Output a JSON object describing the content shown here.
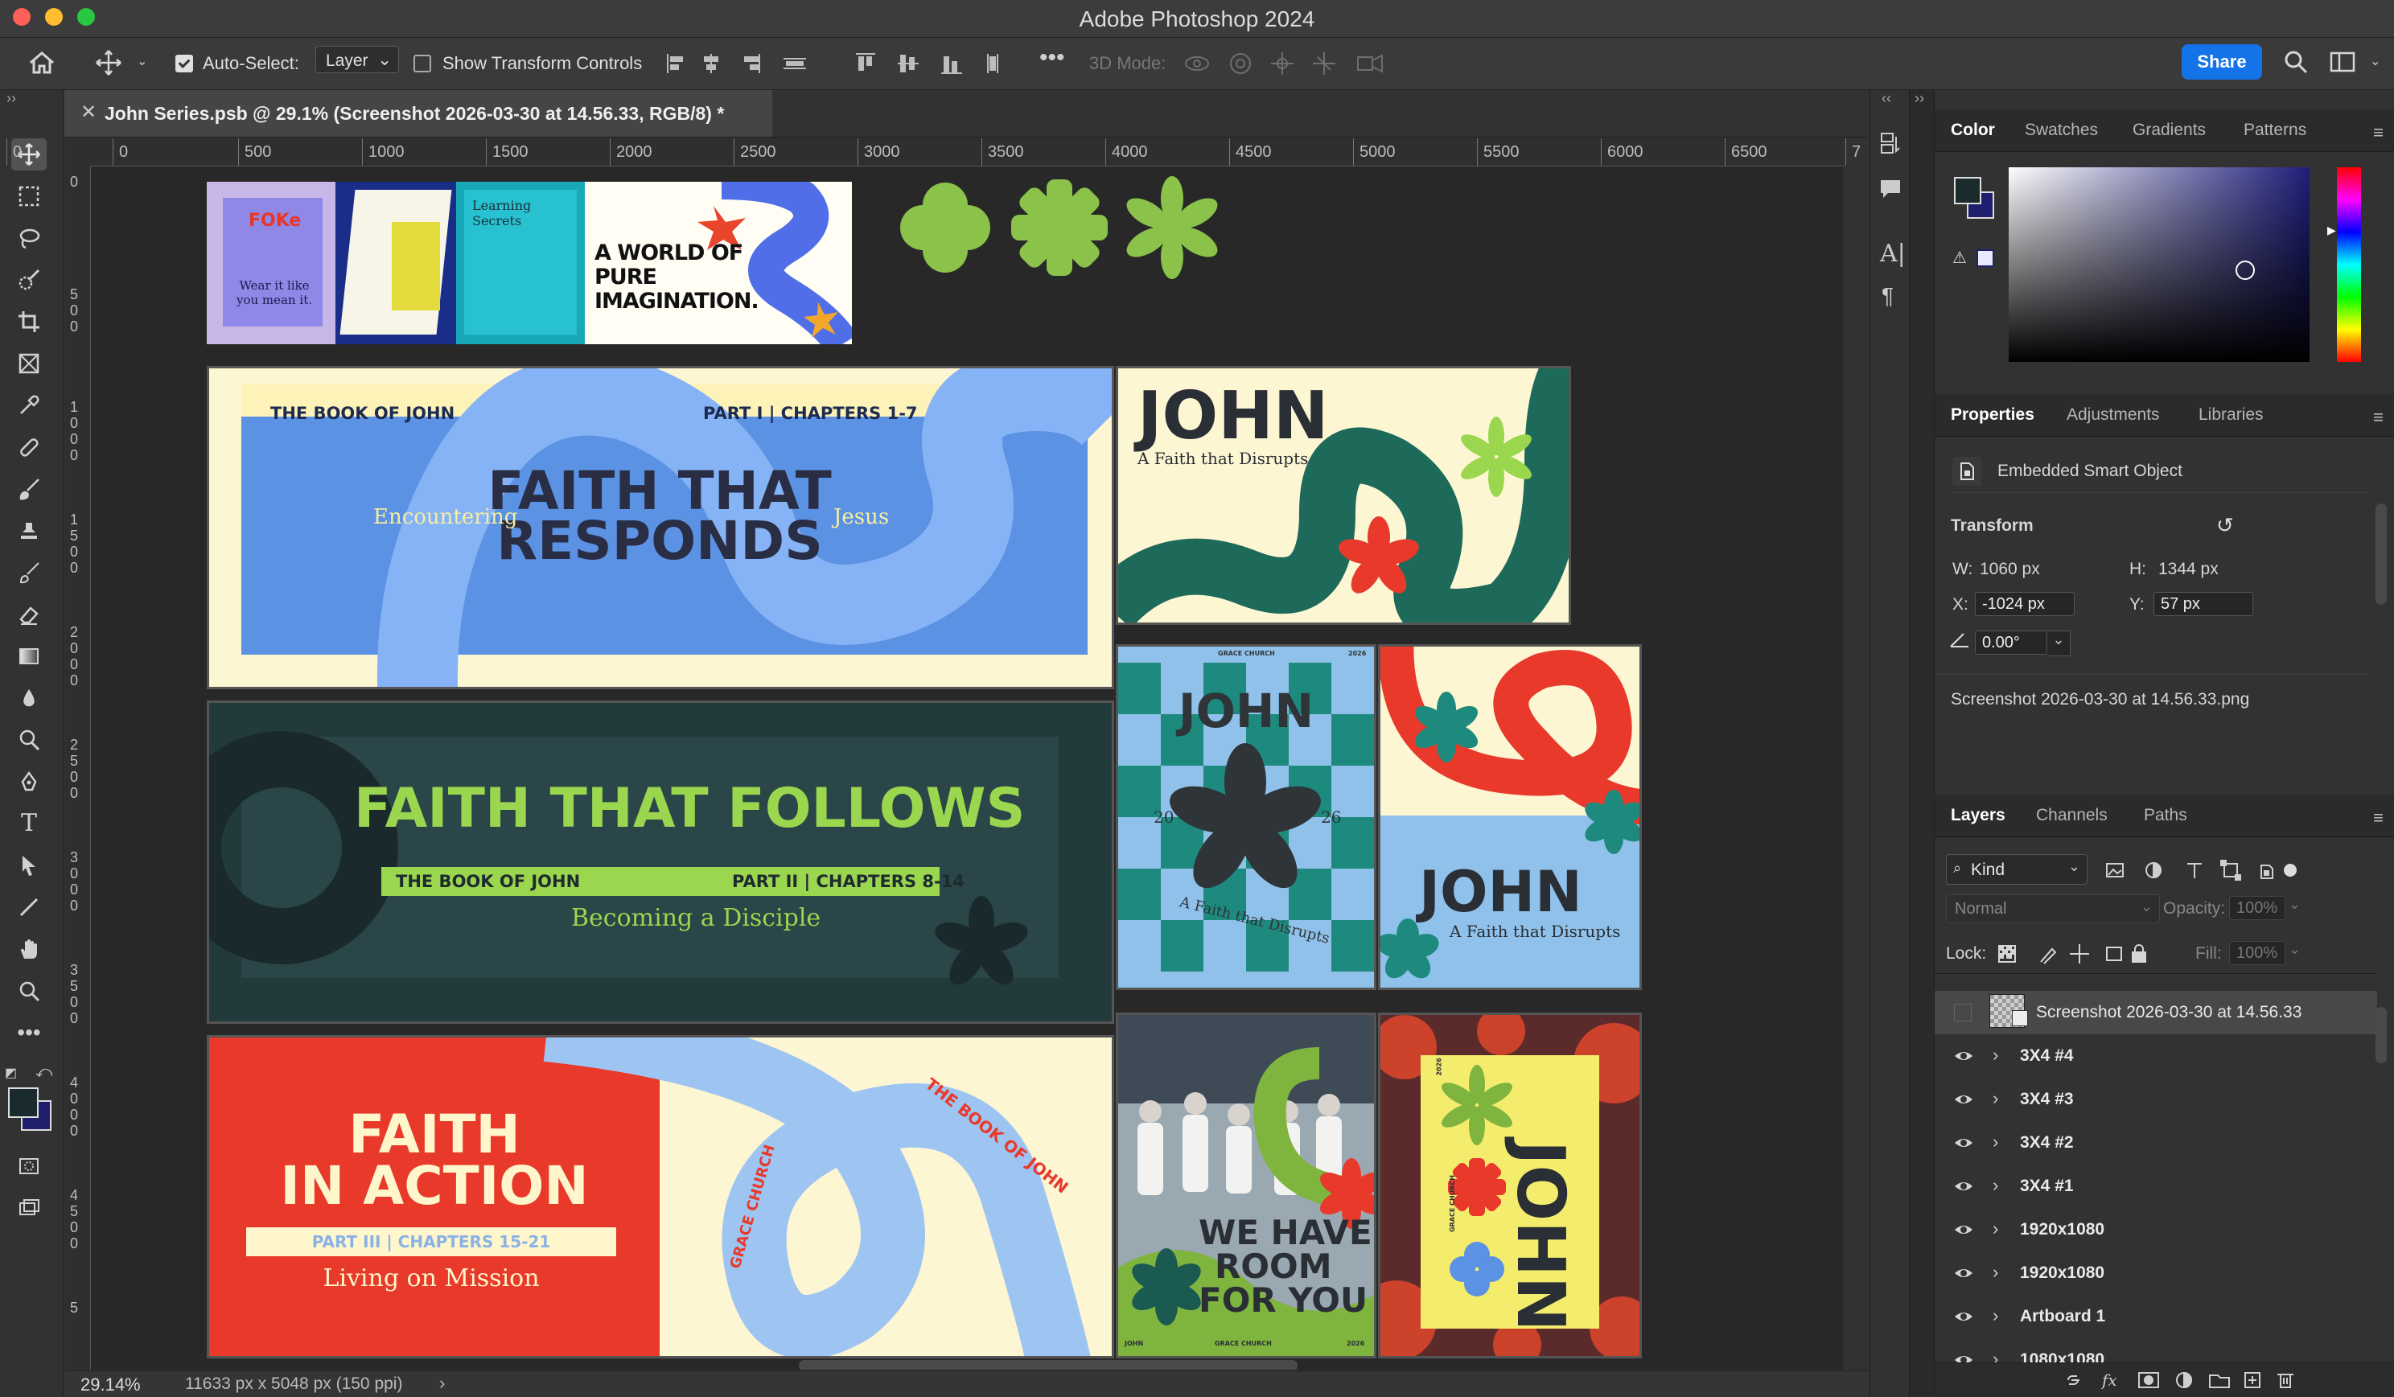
{
  "app": {
    "window_title": "Adobe Photoshop 2024"
  },
  "options_bar": {
    "auto_select_label": "Auto-Select:",
    "auto_select_value": "Layer",
    "show_transform_label": "Show Transform Controls",
    "mode_3d_label": "3D Mode:",
    "share_label": "Share"
  },
  "document": {
    "tab_title": "John Series.psb @ 29.1% (Screenshot 2026-03-30 at 14.56.33, RGB/8) *",
    "zoom": "29.14%",
    "doc_size": "11633 px x 5048 px (150 ppi)"
  },
  "ruler": {
    "h_labels": [
      "0",
      "0",
      "500",
      "1000",
      "1500",
      "2000",
      "2500",
      "3000",
      "3500",
      "4000",
      "4500",
      "5000",
      "5500",
      "6000",
      "6500",
      "7"
    ],
    "v_labels": [
      "0",
      "500",
      "1000",
      "1500",
      "2000",
      "2500",
      "3000",
      "3500",
      "4000",
      "4500",
      "5"
    ]
  },
  "artboards": {
    "strip": {
      "foke": "FOKe",
      "foke_sub": "Wear it like you mean it.",
      "learning": "Learning Secrets",
      "world": "A WORLD OF PURE IMAGINATION."
    },
    "b1": {
      "left": "THE BOOK OF JOHN",
      "right": "PART I | CHAPTERS 1-7",
      "main": "FAITH THAT RESPONDS",
      "side_l": "Encountering",
      "side_r": "Jesus"
    },
    "b2": {
      "main": "FAITH THAT FOLLOWS",
      "left": "THE BOOK OF JOHN",
      "right": "PART II | CHAPTERS 8-14",
      "sub": "Becoming a Disciple"
    },
    "b3": {
      "main1": "FAITH",
      "main2": "IN ACTION",
      "part": "PART III | CHAPTERS 15-21",
      "sub": "Living on Mission",
      "arc1": "THE BOOK OF JOHN",
      "arc2": "GRACE CHURCH"
    },
    "p1": {
      "title": "JOHN",
      "sub": "A Faith that Disrupts"
    },
    "p2": {
      "title": "JOHN",
      "year_l": "20",
      "year_r": "26",
      "sub": "A Faith that Disrupts",
      "top_l": "GRACE CHURCH",
      "top_r": "2026"
    },
    "p3": {
      "title": "JOHN",
      "sub": "A Faith that Disrupts"
    },
    "p4": {
      "line1": "WE HAVE",
      "line2": "ROOM",
      "line3": "FOR YOU",
      "small": "GRACE CHURCH",
      "year": "2026",
      "corner": "JOHN"
    },
    "p5": {
      "title": "JOHN",
      "side": "GRACE CHURCH",
      "year": "2026"
    }
  },
  "color_panel": {
    "tabs": [
      "Color",
      "Swatches",
      "Gradients",
      "Patterns"
    ],
    "fg_color": "#1a2b2e",
    "bg_color": "#1f1f6e",
    "hue_color": "#1e1e7a"
  },
  "properties_panel": {
    "tabs": [
      "Properties",
      "Adjustments",
      "Libraries"
    ],
    "object_type": "Embedded Smart Object",
    "transform_label": "Transform",
    "w_label": "W:",
    "w_value": "1060 px",
    "h_label": "H:",
    "h_value": "1344 px",
    "x_label": "X:",
    "x_value": "-1024 px",
    "y_label": "Y:",
    "y_value": "57 px",
    "angle_value": "0.00°",
    "source_name": "Screenshot 2026-03-30 at 14.56.33.png"
  },
  "layers_panel": {
    "tabs": [
      "Layers",
      "Channels",
      "Paths"
    ],
    "filter_kind": "Kind",
    "blend_mode": "Normal",
    "opacity_label": "Opacity:",
    "opacity_value": "100%",
    "lock_label": "Lock:",
    "fill_label": "Fill:",
    "fill_value": "100%",
    "layers": [
      {
        "name": "Screenshot 2026-03-30 at 14.56.33",
        "visible": false,
        "group": false,
        "selected": true
      },
      {
        "name": "3X4 #4",
        "visible": true,
        "group": true
      },
      {
        "name": "3X4 #3",
        "visible": true,
        "group": true
      },
      {
        "name": "3X4 #2",
        "visible": true,
        "group": true
      },
      {
        "name": "3X4 #1",
        "visible": true,
        "group": true
      },
      {
        "name": "1920x1080",
        "visible": true,
        "group": true
      },
      {
        "name": "1920x1080",
        "visible": true,
        "group": true
      },
      {
        "name": "Artboard 1",
        "visible": true,
        "group": true
      },
      {
        "name": "1080x1080",
        "visible": true,
        "group": true
      }
    ]
  }
}
